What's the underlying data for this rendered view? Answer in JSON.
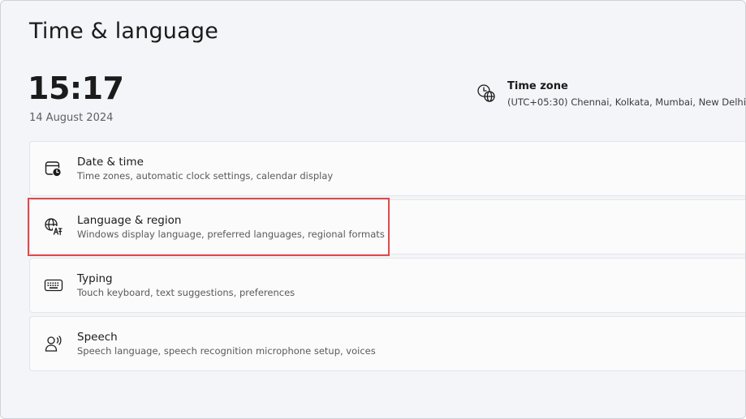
{
  "page": {
    "title": "Time & language"
  },
  "clock": {
    "time": "15:17",
    "date": "14 August 2024"
  },
  "timezone": {
    "title": "Time zone",
    "value": "(UTC+05:30) Chennai, Kolkata, Mumbai, New Delhi",
    "icon": "clock-globe-icon"
  },
  "items": [
    {
      "title": "Date & time",
      "subtitle": "Time zones, automatic clock settings, calendar display",
      "icon": "calendar-clock-icon"
    },
    {
      "title": "Language & region",
      "subtitle": "Windows display language, preferred languages, regional formats",
      "icon": "language-icon",
      "highlighted": true
    },
    {
      "title": "Typing",
      "subtitle": "Touch keyboard, text suggestions, preferences",
      "icon": "keyboard-icon"
    },
    {
      "title": "Speech",
      "subtitle": "Speech language, speech recognition microphone setup, voices",
      "icon": "speech-icon"
    }
  ],
  "colors": {
    "background": "#f3f5f8",
    "card": "#fbfbfc",
    "highlight": "#e5474b",
    "text": "#1b1b1b"
  }
}
